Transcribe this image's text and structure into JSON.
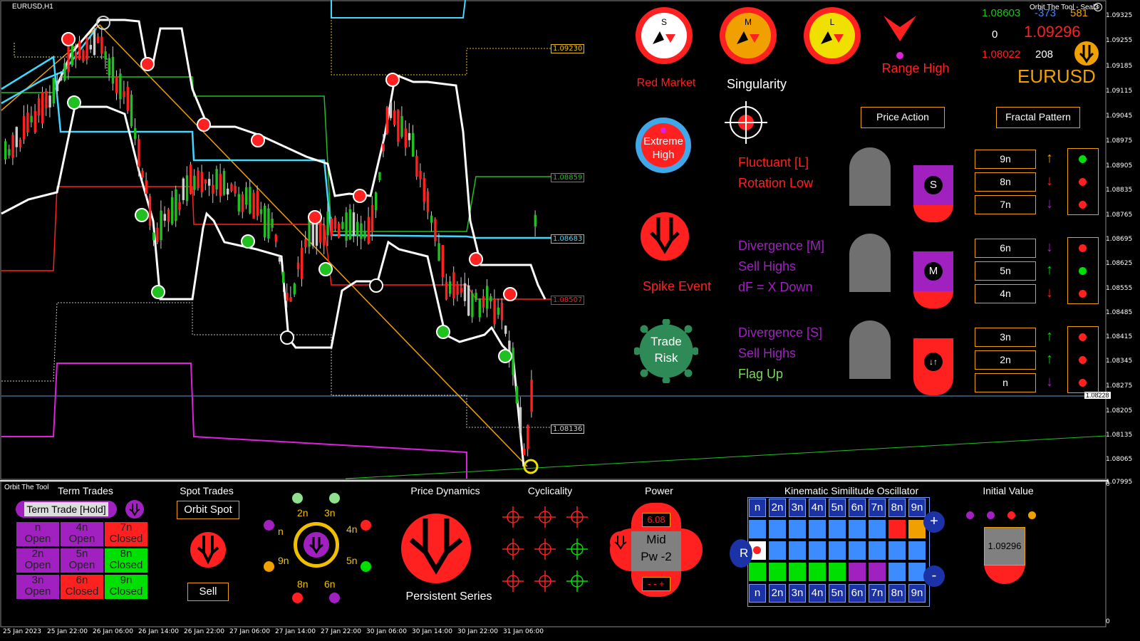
{
  "window": {
    "symbol_tf": "EURUSD,H1",
    "brand": "Orbit The Tool - Seal3"
  },
  "price_axis": [
    "1.09325",
    "1.09255",
    "1.09185",
    "1.09115",
    "1.09045",
    "1.08975",
    "1.08905",
    "1.08835",
    "1.08765",
    "1.08695",
    "1.08625",
    "1.08555",
    "1.08485",
    "1.08415",
    "1.08345",
    "1.08275",
    "1.08228",
    "1.08205",
    "1.08135",
    "1.08065",
    "1.07995"
  ],
  "lower_axis": [
    "0",
    "0"
  ],
  "time_axis": [
    "25 Jan 2023",
    "25 Jan 22:00",
    "26 Jan 06:00",
    "26 Jan 14:00",
    "26 Jan 22:00",
    "27 Jan 06:00",
    "27 Jan 14:00",
    "27 Jan 22:00",
    "30 Jan 06:00",
    "30 Jan 14:00",
    "30 Jan 22:00",
    "31 Jan 06:00"
  ],
  "levels": {
    "l1": "1.09230",
    "l2": "1.08859",
    "l3": "1.08683",
    "l4": "1.08507",
    "l5": "1.08136"
  },
  "quote": {
    "high": "1.08603",
    "points": "-373",
    "count": "581",
    "zero": "0",
    "bid": "1.09296",
    "low": "1.08022",
    "bars": "208",
    "symbol": "EURUSD"
  },
  "indicators": {
    "s_letter": "S",
    "m_letter": "M",
    "l_letter": "L",
    "red_market": "Red Market",
    "singularity": "Singularity",
    "range_high": "Range High",
    "extreme": "Extreme",
    "extreme_high": "High",
    "price_action": "Price Action",
    "fractal_pattern": "Fractal Pattern",
    "spike_event": "Spike Event",
    "trade": "Trade",
    "risk": "Risk"
  },
  "signals": {
    "fluctuant": "Fluctuant [L]",
    "rotation": "Rotation Low",
    "div_m": "Divergence [M]",
    "sell_m": "Sell Highs",
    "df": "dF = X Down",
    "div_s": "Divergence [S]",
    "sell_s": "Sell Highs",
    "flag": "Flag Up",
    "badge_s": "S",
    "badge_m": "M"
  },
  "fractal_rows": [
    {
      "label": "9n",
      "arrow": "↑",
      "arrow_color": "#f0a000",
      "dot": "#00e000"
    },
    {
      "label": "8n",
      "arrow": "↓",
      "arrow_color": "#ff2020",
      "dot": "#ff2020"
    },
    {
      "label": "7n",
      "arrow": "↓",
      "arrow_color": "#a020c0",
      "dot": "#ff2020"
    },
    {
      "label": "6n",
      "arrow": "↓",
      "arrow_color": "#a020c0",
      "dot": "#ff2020"
    },
    {
      "label": "5n",
      "arrow": "↑",
      "arrow_color": "#00e000",
      "dot": "#00e000"
    },
    {
      "label": "4n",
      "arrow": "↓",
      "arrow_color": "#ff2020",
      "dot": "#ff2020"
    },
    {
      "label": "3n",
      "arrow": "↑",
      "arrow_color": "#00e000",
      "dot": "#ff2020"
    },
    {
      "label": "2n",
      "arrow": "↑",
      "arrow_color": "#00e000",
      "dot": "#ff2020"
    },
    {
      "label": "n",
      "arrow": "↓",
      "arrow_color": "#a020c0",
      "dot": "#ff2020"
    }
  ],
  "panel": {
    "brand": "Orbit The Tool",
    "term_title": "Term Trades",
    "term_btn": "Term Trade [Hold]",
    "term_cells": [
      {
        "l1": "n",
        "l2": "Open",
        "bg": "#a020c0"
      },
      {
        "l1": "4n",
        "l2": "Open",
        "bg": "#a020c0"
      },
      {
        "l1": "7n",
        "l2": "Closed",
        "bg": "#ff2020"
      },
      {
        "l1": "2n",
        "l2": "Open",
        "bg": "#a020c0"
      },
      {
        "l1": "5n",
        "l2": "Open",
        "bg": "#a020c0"
      },
      {
        "l1": "8n",
        "l2": "Closed",
        "bg": "#00e000"
      },
      {
        "l1": "3n",
        "l2": "Open",
        "bg": "#a020c0"
      },
      {
        "l1": "6n",
        "l2": "Closed",
        "bg": "#ff2020"
      },
      {
        "l1": "9n",
        "l2": "Closed",
        "bg": "#00e000"
      }
    ],
    "spot_title": "Spot Trades",
    "spot_btn": "Orbit Spot",
    "sell_btn": "Sell",
    "ring_labels": [
      "2n",
      "3n",
      "4n",
      "5n",
      "6n",
      "8n",
      "9n",
      "n"
    ],
    "pd_title": "Price Dynamics",
    "persistent": "Persistent Series",
    "cyc_title": "Cyclicality",
    "power_title": "Power",
    "power_val": "6.08",
    "mid": "Mid",
    "pw": "Pw -2",
    "pm": "- - +",
    "kso_title": "Kinematic Similitude Oscillator",
    "kso_headers": [
      "n",
      "2n",
      "3n",
      "4n",
      "5n",
      "6n",
      "7n",
      "8n",
      "9n"
    ],
    "kso_r": "R",
    "kso_plus": "+",
    "kso_minus": "-",
    "iv_title": "Initial Value",
    "iv_value": "1.09296"
  },
  "colors": {
    "accent": "#f0a000",
    "red": "#ff2020",
    "green": "#00e000",
    "purple": "#a020c0",
    "cyan": "#40d8ff",
    "kso_blue": "#3c8cff"
  }
}
